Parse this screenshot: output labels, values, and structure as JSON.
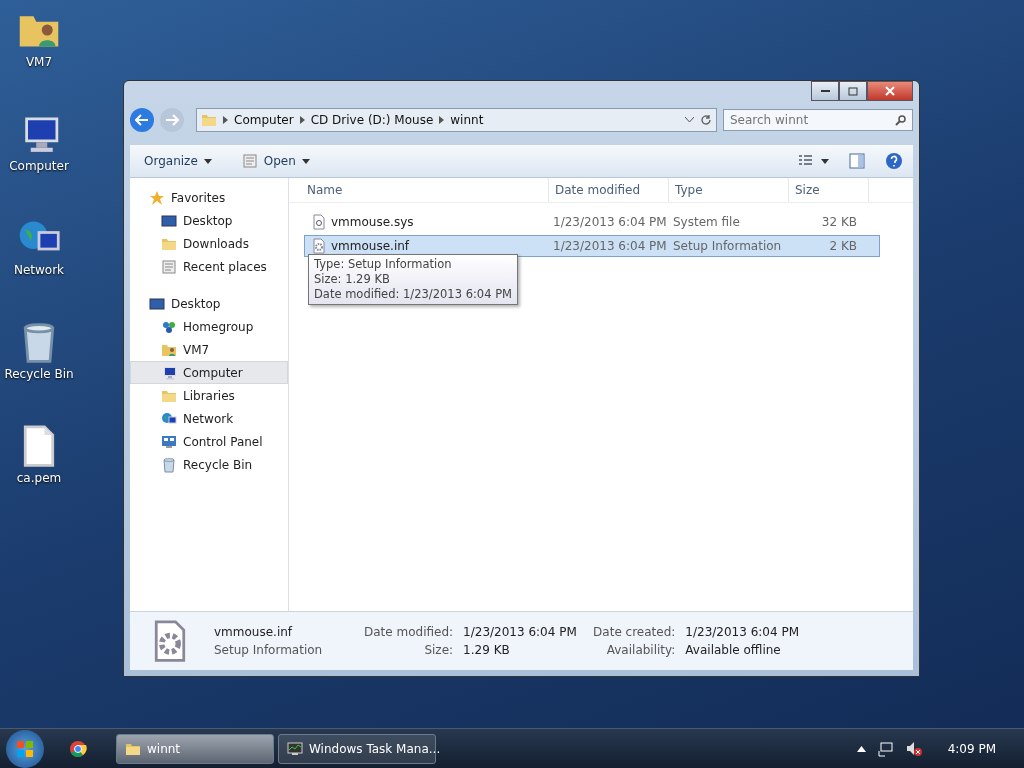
{
  "desktop_icons": [
    {
      "kind": "user-folder",
      "label": "VM7"
    },
    {
      "kind": "computer",
      "label": "Computer"
    },
    {
      "kind": "network",
      "label": "Network"
    },
    {
      "kind": "recycle",
      "label": "Recycle Bin"
    },
    {
      "kind": "file",
      "label": "ca.pem"
    }
  ],
  "window": {
    "address": {
      "crumbs": [
        "Computer",
        "CD Drive (D:) Mouse",
        "winnt"
      ]
    },
    "search": {
      "placeholder": "Search winnt"
    },
    "toolbar": [
      "Organize",
      "Open"
    ],
    "sidebar": {
      "groups": [
        {
          "label": "Favorites",
          "kind": "star",
          "selected": false,
          "children": [
            {
              "label": "Desktop",
              "kind": "desktop",
              "selected": false
            },
            {
              "label": "Downloads",
              "kind": "folder",
              "selected": false
            },
            {
              "label": "Recent places",
              "kind": "recent",
              "selected": false
            }
          ]
        },
        {
          "label": "Desktop",
          "kind": "desktop",
          "selected": false,
          "children": [
            {
              "label": "Homegroup",
              "kind": "homegroup",
              "selected": false
            },
            {
              "label": "VM7",
              "kind": "user-folder",
              "selected": false
            },
            {
              "label": "Computer",
              "kind": "computer",
              "selected": true
            },
            {
              "label": "Libraries",
              "kind": "folder",
              "selected": false
            },
            {
              "label": "Network",
              "kind": "network",
              "selected": false
            },
            {
              "label": "Control Panel",
              "kind": "control",
              "selected": false
            },
            {
              "label": "Recycle Bin",
              "kind": "recycle",
              "selected": false
            }
          ]
        }
      ]
    },
    "table": {
      "columns": [
        "Name",
        "Date modified",
        "Type",
        "Size"
      ],
      "rows": [
        {
          "kind": "sys",
          "name": "vmmouse.sys",
          "date": "1/23/2013 6:04 PM",
          "type": "System file",
          "size": "32 KB",
          "selected": false
        },
        {
          "kind": "inf",
          "name": "vmmouse.inf",
          "date": "1/23/2013 6:04 PM",
          "type": "Setup Information",
          "size": "2 KB",
          "selected": true
        }
      ]
    },
    "tooltip": [
      "Type: Setup Information",
      "Size: 1.29 KB",
      "Date modified: 1/23/2013 6:04 PM"
    ],
    "details": {
      "name": "vmmouse.inf",
      "type": "Setup Information",
      "fields": [
        {
          "label": "Date modified:",
          "value": "1/23/2013 6:04 PM"
        },
        {
          "label": "Size:",
          "value": "1.29 KB"
        },
        {
          "label": "Date created:",
          "value": "1/23/2013 6:04 PM"
        },
        {
          "label": "Availability:",
          "value": "Available offline"
        }
      ]
    }
  },
  "taskbar": {
    "items": [
      {
        "kind": "folder",
        "label": "winnt",
        "selected": true
      },
      {
        "kind": "taskmgr",
        "label": "Windows Task Mana...",
        "selected": false
      }
    ],
    "clock": "4:09 PM"
  }
}
